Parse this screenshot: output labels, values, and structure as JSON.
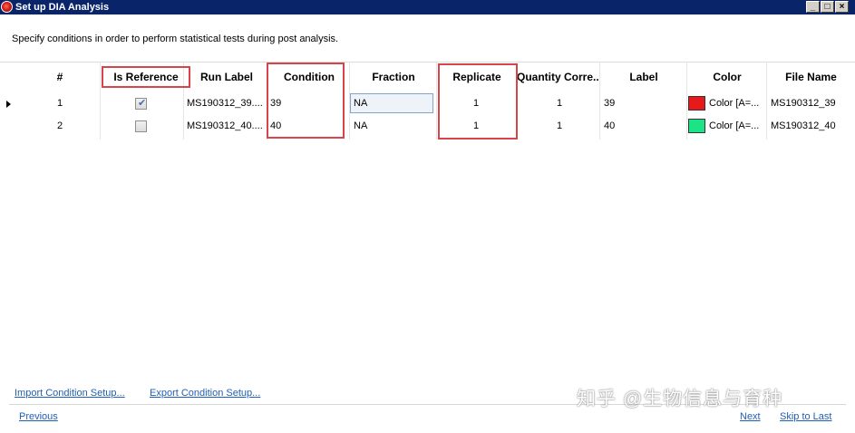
{
  "window": {
    "title": "Set up DIA Analysis",
    "buttons": {
      "minimize": "_",
      "maximize": "□",
      "close": "×"
    }
  },
  "instruction": "Specify conditions in order to perform statistical tests during post analysis.",
  "table": {
    "columns": [
      "#",
      "Is Reference",
      "Run Label",
      "Condition",
      "Fraction",
      "Replicate",
      "Quantity Corre...",
      "Label",
      "Color",
      "File Name"
    ],
    "rows": [
      {
        "num": "1",
        "is_reference": true,
        "run_label": "MS190312_39....",
        "condition": "39",
        "fraction": "NA",
        "replicate": "1",
        "quantity_correction": "1",
        "label": "39",
        "color_text": "Color [A=...",
        "color_hex": "#e8191b",
        "file_name": "MS190312_39",
        "current": true
      },
      {
        "num": "2",
        "is_reference": false,
        "run_label": "MS190312_40....",
        "condition": "40",
        "fraction": "NA",
        "replicate": "1",
        "quantity_correction": "1",
        "label": "40",
        "color_text": "Color [A=...",
        "color_hex": "#1de387",
        "file_name": "MS190312_40",
        "current": false
      }
    ]
  },
  "links": {
    "import": "Import Condition Setup...",
    "export": "Export Condition Setup...",
    "previous": "Previous",
    "next": "Next",
    "skip_to_last": "Skip to Last"
  },
  "watermark": "知乎 @生物信息与育种",
  "colors": {
    "titlebar": "#0a246a",
    "highlight_box": "#d9444a",
    "link": "#1f5fb5"
  }
}
